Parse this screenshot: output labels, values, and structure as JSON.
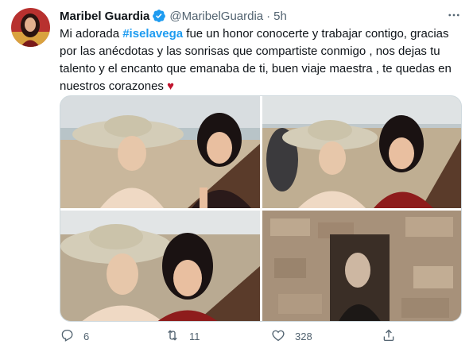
{
  "tweet": {
    "author_name": "Maribel Guardia",
    "handle": "@MaribelGuardia",
    "separator": "·",
    "time": "5h",
    "more_label": "···",
    "text_part1": "Mi adorada ",
    "hashtag": "#iselavega",
    "text_part2": " fue un honor conocerte y trabajar contigo, gracias por las anécdotas y las sonrisas que compartiste conmigo , nos dejas tu talento y el encanto que emanaba de ti, buen viaje maestra , te quedas en nuestros corazones ",
    "heart": "♥"
  },
  "colors": {
    "hashtag": "#1d9bf0",
    "verified": "#1d9bf0",
    "muted": "#536471",
    "heart": "#c0152f"
  },
  "icons": {
    "verified": "verified-badge-icon",
    "reply": "reply-icon",
    "retweet": "retweet-icon",
    "like": "heart-icon",
    "share": "share-icon",
    "more": "more-icon"
  },
  "actions": {
    "reply_count": "6",
    "retweet_count": "11",
    "like_count": "328"
  }
}
